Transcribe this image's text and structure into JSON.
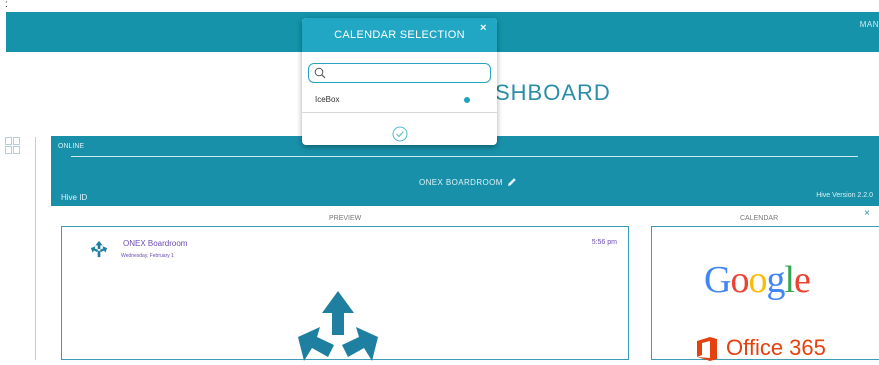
{
  "top_mark": ":",
  "header": {
    "right_text": "MAN"
  },
  "dashboard_title": "SHBOARD",
  "hive": {
    "status": "ONLINE",
    "room_name": "ONEX BOARDROOM",
    "hive_id_label": "Hive ID",
    "version_label": "Hive Version 2.2.0",
    "close_label": "×",
    "preview_label": "PREVIEW",
    "calendar_label": "CALENDAR"
  },
  "preview": {
    "room_name": "ONEX Boardroom",
    "date": "Wednesday, February 1",
    "time": "5:56 pm"
  },
  "calendar_options": {
    "google": "Google",
    "office": "Office 365"
  },
  "modal": {
    "title": "CALENDAR SELECTION",
    "close_label": "×",
    "search_value": "",
    "options": [
      {
        "label": "IceBox",
        "selected": true
      }
    ]
  },
  "colors": {
    "header": "#1493aa",
    "modal_header": "#21a7c4",
    "accent": "#1ea3c1",
    "google_blue": "#4285F4",
    "google_red": "#EA4335",
    "google_yellow": "#FBBC05",
    "google_green": "#34A853",
    "office_orange": "#e5400f"
  },
  "icons": {
    "pencil": "pencil-icon",
    "search": "search-icon",
    "confirm": "check-circle-icon",
    "grid": "grid-icon"
  }
}
